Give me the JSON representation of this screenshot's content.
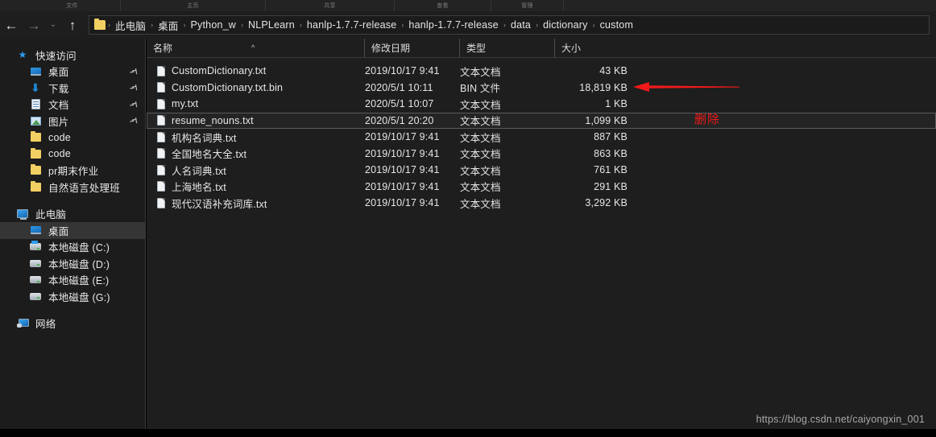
{
  "window": {
    "ribbon_tabs": [
      "文件",
      "主页",
      "共享",
      "查看",
      "管理"
    ]
  },
  "toolbar": {
    "back": "←",
    "forward": "→",
    "history": "⌄",
    "up": "↑",
    "folder_icon": "folder-icon"
  },
  "address": {
    "separator": "›",
    "crumbs": [
      "此电脑",
      "桌面",
      "Python_w",
      "NLPLearn",
      "hanlp-1.7.7-release",
      "hanlp-1.7.7-release",
      "data",
      "dictionary",
      "custom"
    ]
  },
  "sidebar": {
    "groups": [
      {
        "header": {
          "label": "快速访问",
          "icon": "star-icon"
        },
        "items": [
          {
            "label": "桌面",
            "icon": "desktop-icon",
            "pinned": true
          },
          {
            "label": "下载",
            "icon": "download-icon",
            "pinned": true
          },
          {
            "label": "文档",
            "icon": "documents-icon",
            "pinned": true
          },
          {
            "label": "图片",
            "icon": "pictures-icon",
            "pinned": true
          },
          {
            "label": "code",
            "icon": "folder-icon",
            "pinned": false
          },
          {
            "label": "code",
            "icon": "folder-icon",
            "pinned": false
          },
          {
            "label": "pr期末作业",
            "icon": "folder-icon",
            "pinned": false
          },
          {
            "label": "自然语言处理班",
            "icon": "folder-icon",
            "pinned": false
          }
        ]
      },
      {
        "header": {
          "label": "此电脑",
          "icon": "this-pc-icon"
        },
        "items": [
          {
            "label": "桌面",
            "icon": "desktop-icon",
            "selected": true
          },
          {
            "label": "本地磁盘 (C:)",
            "icon": "system-drive-icon"
          },
          {
            "label": "本地磁盘 (D:)",
            "icon": "drive-icon"
          },
          {
            "label": "本地磁盘 (E:)",
            "icon": "drive-icon"
          },
          {
            "label": "本地磁盘 (G:)",
            "icon": "drive-icon"
          }
        ]
      },
      {
        "header": {
          "label": "网络",
          "icon": "network-icon"
        },
        "items": []
      }
    ]
  },
  "file_list": {
    "columns": [
      "名称",
      "修改日期",
      "类型",
      "大小"
    ],
    "sort_column": "名称",
    "sort_direction": "ascending",
    "rows": [
      {
        "name": "CustomDictionary.txt",
        "date": "2019/10/17 9:41",
        "type": "文本文档",
        "size": "43 KB",
        "selected": false
      },
      {
        "name": "CustomDictionary.txt.bin",
        "date": "2020/5/1 10:11",
        "type": "BIN 文件",
        "size": "18,819 KB",
        "selected": false
      },
      {
        "name": "my.txt",
        "date": "2020/5/1 10:07",
        "type": "文本文档",
        "size": "1 KB",
        "selected": false
      },
      {
        "name": "resume_nouns.txt",
        "date": "2020/5/1 20:20",
        "type": "文本文档",
        "size": "1,099 KB",
        "selected": true
      },
      {
        "name": "机构名词典.txt",
        "date": "2019/10/17 9:41",
        "type": "文本文档",
        "size": "887 KB",
        "selected": false
      },
      {
        "name": "全国地名大全.txt",
        "date": "2019/10/17 9:41",
        "type": "文本文档",
        "size": "863 KB",
        "selected": false
      },
      {
        "name": "人名词典.txt",
        "date": "2019/10/17 9:41",
        "type": "文本文档",
        "size": "761 KB",
        "selected": false
      },
      {
        "name": "上海地名.txt",
        "date": "2019/10/17 9:41",
        "type": "文本文档",
        "size": "291 KB",
        "selected": false
      },
      {
        "name": "现代汉语补充词库.txt",
        "date": "2019/10/17 9:41",
        "type": "文本文档",
        "size": "3,292 KB",
        "selected": false
      }
    ]
  },
  "annotation": {
    "label": "删除",
    "color": "#f01a1a",
    "arrow": "left-arrow-annotation"
  },
  "watermark": {
    "text": "https://blog.csdn.net/caiyongxin_001"
  },
  "colors": {
    "window_bg": "#1e1e1e",
    "sidebar_bg": "#1c1c1c",
    "accent_folder": "#f2cf62",
    "annotation_red": "#f01a1a",
    "selection": "#353535"
  }
}
